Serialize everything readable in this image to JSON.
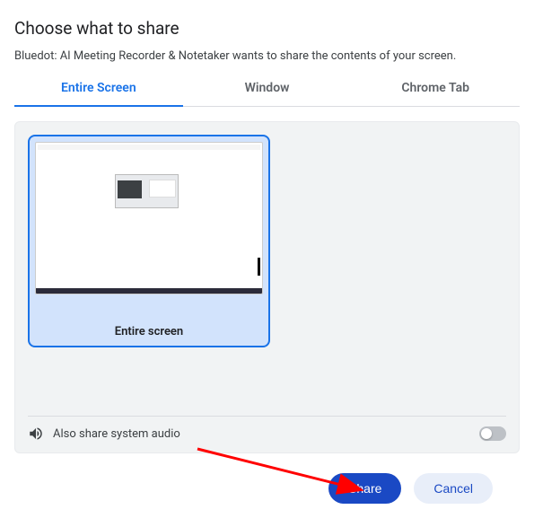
{
  "title": "Choose what to share",
  "subtitle": "Bluedot: AI Meeting Recorder & Notetaker wants to share the contents of your screen.",
  "tabs": {
    "entire": "Entire Screen",
    "window": "Window",
    "chrome": "Chrome Tab"
  },
  "thumbnail_label": "Entire screen",
  "audio_label": "Also share system audio",
  "buttons": {
    "share": "Share",
    "cancel": "Cancel"
  }
}
